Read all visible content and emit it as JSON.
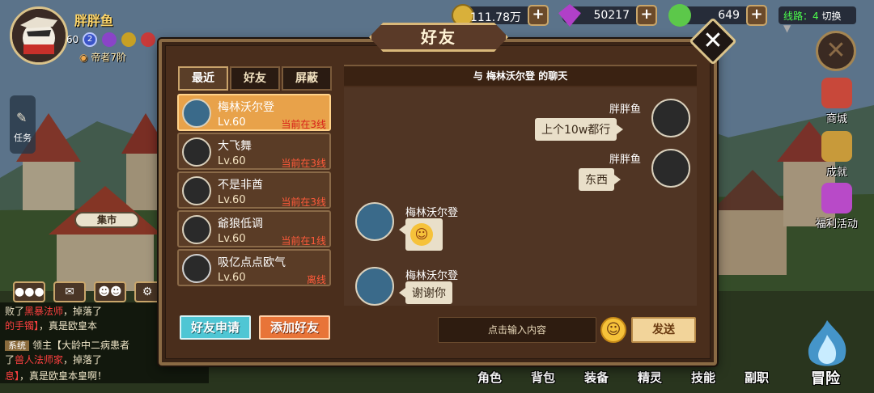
{
  "player": {
    "name": "胖胖鱼",
    "level": "60",
    "badge_level": "2",
    "rank": "帝者7阶"
  },
  "resources": {
    "gold": "111.78万",
    "diamond": "50217",
    "stamina": "649",
    "line_label": "线路：",
    "line_value": "4",
    "line_switch": "切换"
  },
  "left_side": {
    "task_label": "任务",
    "market_label": "集市"
  },
  "chat_log": {
    "line1_a": "败了",
    "line1_red": "黑暴法师",
    "line1_b": "，掉落了",
    "line2_a": "的手镯】",
    "line2_b": "，真是欧皇本",
    "line3_sys": "系统",
    "line3_a": "领主【大龄中二病患者",
    "line4_a": "了",
    "line4_red": "兽人法师家",
    "line4_b": "，掉落了",
    "line5_a": "息】",
    "line5_b": "，真是欧皇本皇啊！"
  },
  "right_side": {
    "shop": "商城",
    "achievement": "成就",
    "welfare": "福利活动"
  },
  "bottom_nav": [
    "角色",
    "背包",
    "装备",
    "精灵",
    "技能",
    "副职"
  ],
  "adventure_label": "冒险",
  "dialog": {
    "title": "好友",
    "tabs": [
      "最近",
      "好友",
      "屏蔽"
    ],
    "friends": [
      {
        "name": "梅林沃尔登",
        "level": "Lv.60",
        "status": "当前在3线"
      },
      {
        "name": "大飞舞",
        "level": "Lv.60",
        "status": "当前在3线"
      },
      {
        "name": "不是非酋",
        "level": "Lv.60",
        "status": "当前在3线"
      },
      {
        "name": "爺狼低调",
        "level": "Lv.60",
        "status": "当前在1线"
      },
      {
        "name": "吸亿点点欧气",
        "level": "Lv.60",
        "status": "离线"
      }
    ],
    "apply_button": "好友申请",
    "add_button": "添加好友",
    "chat_header_prefix": "与",
    "chat_header_name": "梅林沃尔登",
    "chat_header_suffix": "的聊天",
    "messages": [
      {
        "sender": "胖胖鱼",
        "text": "上个10w都行"
      },
      {
        "sender": "胖胖鱼",
        "text": "东西"
      },
      {
        "sender": "梅林沃尔登",
        "text": ""
      },
      {
        "sender": "梅林沃尔登",
        "text": "谢谢你"
      }
    ],
    "input_placeholder": "点击输入内容",
    "send_button": "发送"
  }
}
